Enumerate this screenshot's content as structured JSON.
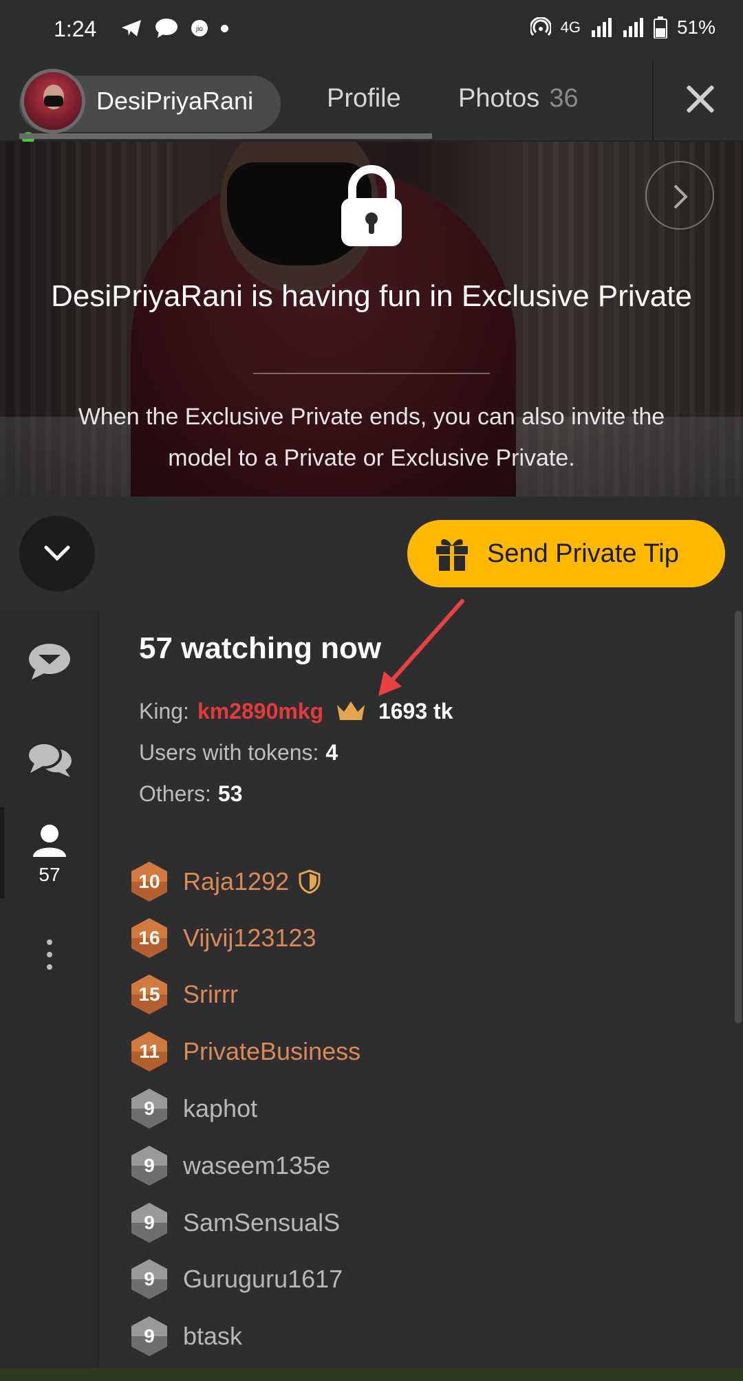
{
  "status_bar": {
    "time": "1:24",
    "network": "4G",
    "battery": "51%"
  },
  "header": {
    "model_name": "DesiPriyaRani",
    "tabs": [
      {
        "label": "Profile"
      },
      {
        "label": "Photos",
        "count": "36"
      }
    ]
  },
  "video": {
    "title": "DesiPriyaRani is having fun in Exclusive Private",
    "subtitle": "When the Exclusive Private ends, you can also invite the model to a Private or Exclusive Private."
  },
  "controls": {
    "tip_button_label": "Send Private Tip",
    "tip_button_color": "#ffb800"
  },
  "sidebar": {
    "users_count": "57"
  },
  "audience": {
    "watching": "57 watching now",
    "king_label": "King:",
    "king_name": "km2890mkg",
    "king_tokens": "1693 tk",
    "users_with_tokens_label": "Users with tokens:",
    "users_with_tokens": "4",
    "others_label": "Others:",
    "others": "53",
    "users": [
      {
        "level": "10",
        "name": "Raja1292",
        "tier": "bronze",
        "shield": true
      },
      {
        "level": "16",
        "name": "Vijvij123123",
        "tier": "bronze"
      },
      {
        "level": "15",
        "name": "Srirrr",
        "tier": "bronze"
      },
      {
        "level": "11",
        "name": "PrivateBusiness",
        "tier": "bronze"
      },
      {
        "level": "9",
        "name": "kaphot",
        "tier": "gray"
      },
      {
        "level": "9",
        "name": "waseem135e",
        "tier": "gray"
      },
      {
        "level": "9",
        "name": "SamSensualS",
        "tier": "gray"
      },
      {
        "level": "9",
        "name": "Guruguru1617",
        "tier": "gray"
      },
      {
        "level": "9",
        "name": "btask",
        "tier": "gray"
      }
    ]
  },
  "colors": {
    "king_name": "#e53a3a",
    "bronze_name": "#dc8a55",
    "gray_name": "#b8b8b8"
  }
}
